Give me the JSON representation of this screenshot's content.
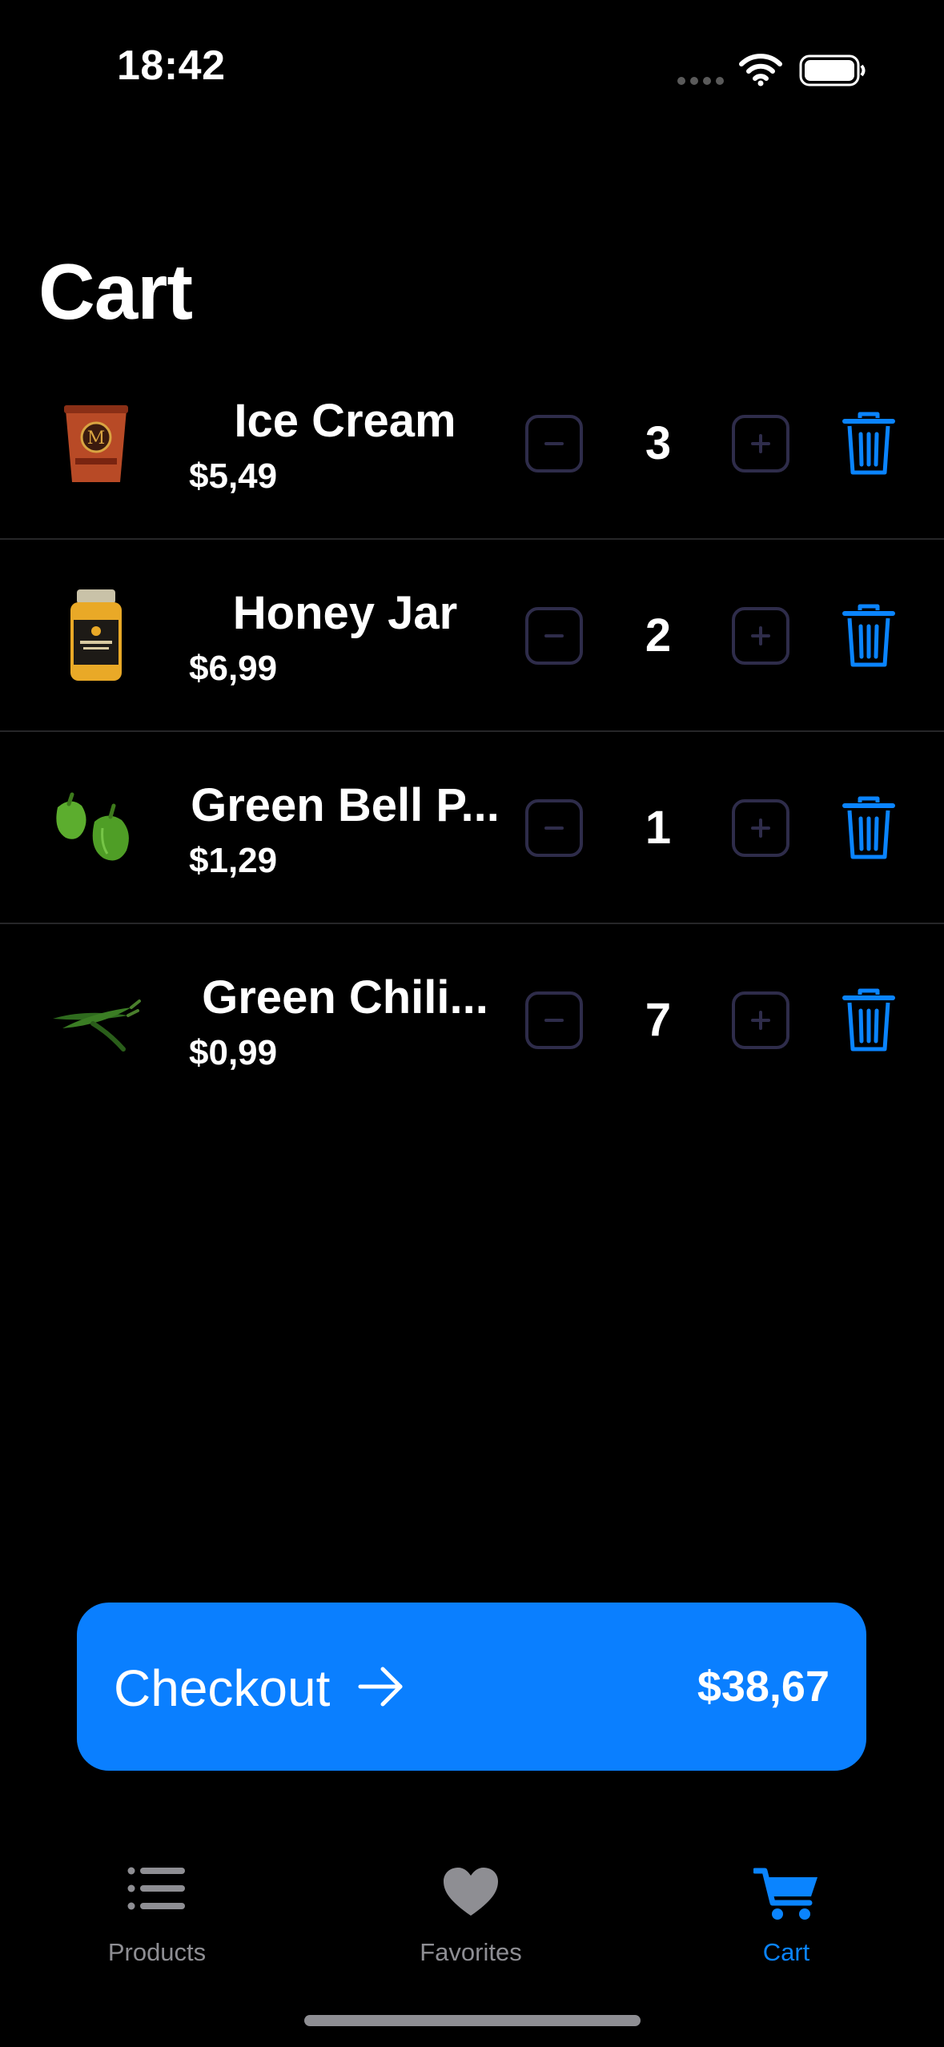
{
  "status_bar": {
    "time": "18:42",
    "icons": [
      "signal-dots-icon",
      "wifi-icon",
      "battery-icon"
    ]
  },
  "page": {
    "title": "Cart"
  },
  "cart": {
    "items": [
      {
        "name": "Ice Cream",
        "price": "$5,49",
        "quantity": "3",
        "image": "ice-cream-thumbnail"
      },
      {
        "name": "Honey Jar",
        "price": "$6,99",
        "quantity": "2",
        "image": "honey-jar-thumbnail"
      },
      {
        "name": "Green Bell P...",
        "price": "$1,29",
        "quantity": "1",
        "image": "green-bell-pepper-thumbnail"
      },
      {
        "name": "Green Chili...",
        "price": "$0,99",
        "quantity": "7",
        "image": "green-chili-thumbnail"
      }
    ]
  },
  "checkout": {
    "label": "Checkout",
    "total": "$38,67",
    "icon": "arrow-right-icon"
  },
  "tab_bar": {
    "tabs": [
      {
        "label": "Products",
        "icon": "list-icon",
        "active": false
      },
      {
        "label": "Favorites",
        "icon": "heart-icon",
        "active": false
      },
      {
        "label": "Cart",
        "icon": "cart-icon",
        "active": true
      }
    ]
  },
  "colors": {
    "background": "#000000",
    "accent": "#0a84ff",
    "checkout_button": "#0a7fff",
    "stepper_border": "#2e2c4a",
    "inactive_tab": "#8e8e93",
    "divider": "#262628"
  }
}
